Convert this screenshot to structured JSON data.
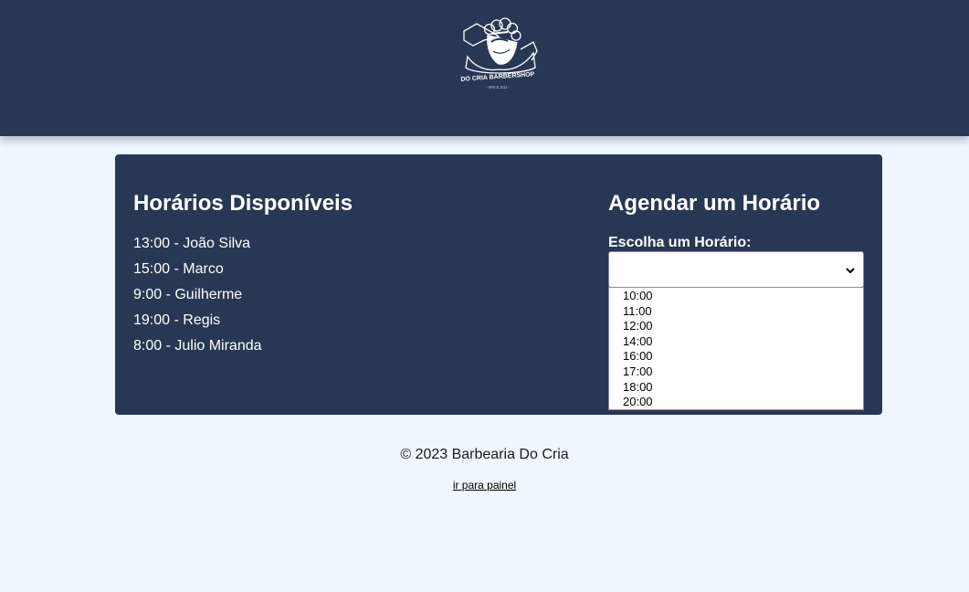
{
  "logo": {
    "brand_text": "DO CRIA BARBERSHOP",
    "since_text": "- SINCE 2023 -"
  },
  "available": {
    "title": "Horários Disponíveis",
    "slots": [
      "13:00 - João Silva",
      "15:00 - Marco",
      "9:00 - Guilherme",
      "19:00 - Regis",
      "8:00 - Julio Miranda"
    ]
  },
  "booking": {
    "title": "Agendar um Horário",
    "select_label": "Escolha um Horário:",
    "selected_value": "",
    "options": [
      "10:00",
      "11:00",
      "12:00",
      "14:00",
      "16:00",
      "17:00",
      "18:00",
      "20:00"
    ]
  },
  "footer": {
    "copyright": "© 2023 Barbearia Do Cria",
    "panel_link": "ir para painel"
  },
  "colors": {
    "header_bg": "#283754",
    "panel_bg": "#283754",
    "page_bg": "#eef6ff"
  }
}
